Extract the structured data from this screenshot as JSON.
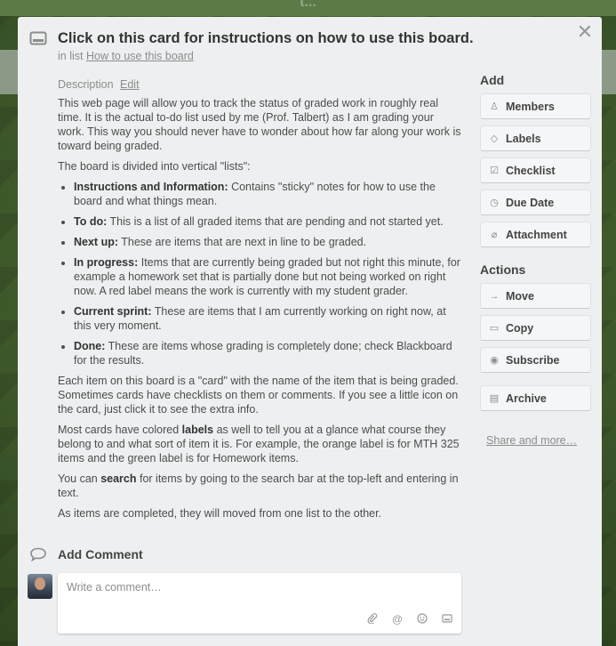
{
  "background": {
    "title": "t..."
  },
  "card": {
    "title": "Click on this card for instructions on how to use this board.",
    "in_list_prefix": "in list",
    "list_name": "How to use this board",
    "close_symbol": "✕"
  },
  "description": {
    "label": "Description",
    "edit": "Edit",
    "p1": "This web page will allow you to track the status of graded work in roughly real time. It is the actual to-do list used by me (Prof. Talbert) as I am grading your work. This way you should never have to wonder about how far along your work is toward being graded.",
    "p2": "The board is divided into vertical \"lists\":",
    "items": [
      {
        "term": "Instructions and Information:",
        "text": " Contains \"sticky\" notes for how to use the board and what things mean."
      },
      {
        "term": "To do:",
        "text": " This is a list of all graded items that are pending and not started yet."
      },
      {
        "term": "Next up:",
        "text": " These are items that are next in line to be graded."
      },
      {
        "term": "In progress:",
        "text": " Items that are currently being graded but not right this minute, for example a homework set that is partially done but not being worked on right now. A red label means the work is currently with my student grader."
      },
      {
        "term": "Current sprint:",
        "text": " These are items that I am currently working on right now, at this very moment."
      },
      {
        "term": "Done:",
        "text": " These are items whose grading is completely done; check Blackboard for the results."
      }
    ],
    "p3": "Each item on this board is a \"card\" with the name of the item that is being graded. Sometimes cards have checklists on them or comments. If you see a little icon on the card, just click it to see the extra info.",
    "p4_a": "Most cards have colored ",
    "p4_b": "labels",
    "p4_c": " as well to tell you at a glance what course they belong to and what sort of item it is. For example, the orange label is for MTH 325 items and the green label is for Homework items.",
    "p5_a": "You can ",
    "p5_b": "search",
    "p5_c": " for items by going to the search bar at the top-left and entering in text.",
    "p6": "As items are completed, they will moved from one list to the other."
  },
  "comment": {
    "title": "Add Comment",
    "placeholder": "Write a comment…"
  },
  "sidebar": {
    "add_heading": "Add",
    "add_buttons": [
      {
        "label": "Members",
        "icon": "person-icon"
      },
      {
        "label": "Labels",
        "icon": "tag-icon"
      },
      {
        "label": "Checklist",
        "icon": "checkbox-icon"
      },
      {
        "label": "Due Date",
        "icon": "clock-icon"
      },
      {
        "label": "Attachment",
        "icon": "paperclip-icon"
      }
    ],
    "actions_heading": "Actions",
    "action_buttons": [
      {
        "label": "Move",
        "icon": "arrow-right-icon"
      },
      {
        "label": "Copy",
        "icon": "card-icon"
      },
      {
        "label": "Subscribe",
        "icon": "eye-icon"
      },
      {
        "label": "Archive",
        "icon": "archive-icon"
      }
    ],
    "share": "Share and more…"
  }
}
